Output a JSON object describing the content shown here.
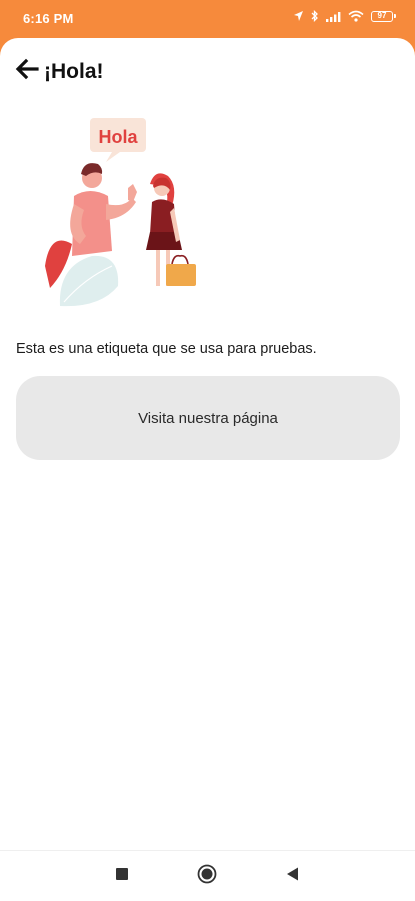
{
  "status_bar": {
    "time": "6:16 PM",
    "battery_level": "97",
    "icons": [
      "location-icon",
      "bluetooth-icon",
      "signal-icon",
      "wifi-icon",
      "battery-icon"
    ]
  },
  "app_bar": {
    "title": "¡Hola!",
    "back_icon": "arrow-left-icon"
  },
  "illustration": {
    "speech_bubble_text": "Hola"
  },
  "content": {
    "description": "Esta es una etiqueta que se usa para pruebas.",
    "button_label": "Visita nuestra página"
  },
  "nav_bar": {
    "icons": [
      "recents-square-icon",
      "home-circle-icon",
      "back-triangle-icon"
    ]
  },
  "colors": {
    "status_bar": "#f68a3c",
    "button_bg": "#e8e8e8",
    "accent_red": "#e0413f"
  }
}
